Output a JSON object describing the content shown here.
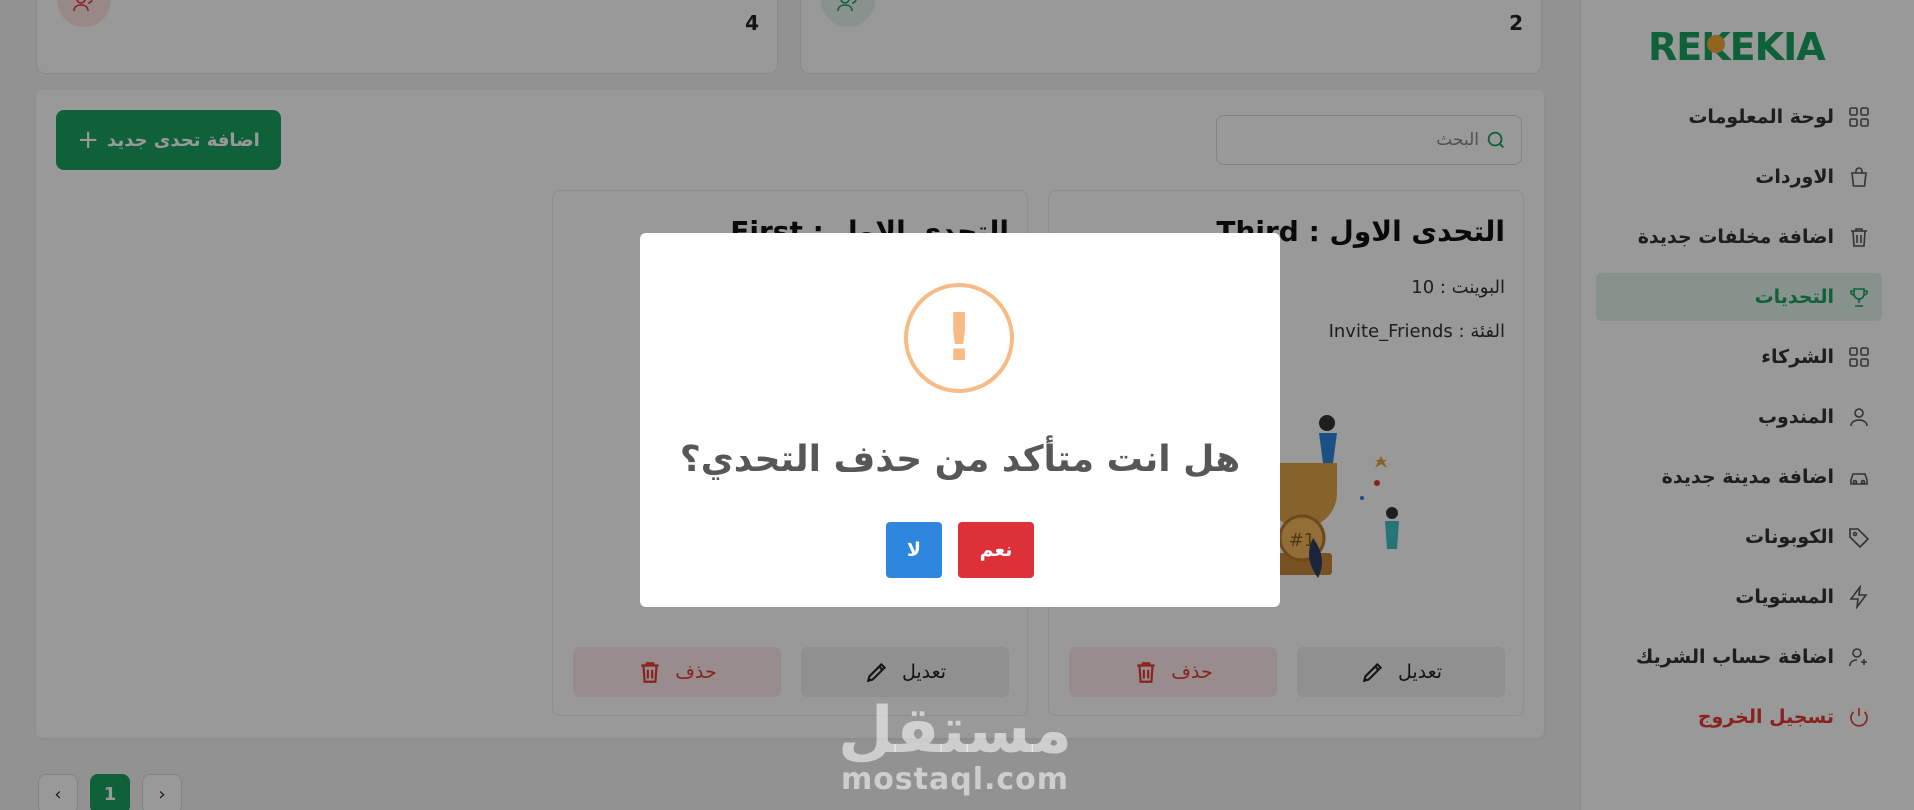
{
  "brand": {
    "logo_text": "REKEKIA",
    "colors": {
      "primary": "#1aa260",
      "danger": "#e53935",
      "warning": "#f8bb86",
      "info": "#2e86de"
    }
  },
  "sidebar": {
    "items": [
      {
        "label": "لوحة المعلومات",
        "icon": "grid-icon"
      },
      {
        "label": "الاوردات",
        "icon": "bag-icon"
      },
      {
        "label": "اضافة مخلفات جديدة",
        "icon": "trash-icon"
      },
      {
        "label": "التحديات",
        "icon": "trophy-icon",
        "active": true
      },
      {
        "label": "الشركاء",
        "icon": "grid-icon"
      },
      {
        "label": "المندوب",
        "icon": "user-icon"
      },
      {
        "label": "اضافة مدينة جديدة",
        "icon": "car-icon"
      },
      {
        "label": "الكوبونات",
        "icon": "tag-icon"
      },
      {
        "label": "المستويات",
        "icon": "bolt-icon"
      },
      {
        "label": "اضافة حساب الشريك",
        "icon": "user-add-icon"
      },
      {
        "label": "تسجيل الخروج",
        "icon": "power-icon"
      }
    ]
  },
  "stats": [
    {
      "value": "4",
      "icon": "users-icon",
      "color": "#e53935"
    },
    {
      "value": "2",
      "icon": "users-icon",
      "color": "#1aa260"
    }
  ],
  "toolbar": {
    "add_label": "اضافة تحدى جديد",
    "add_plus": "+",
    "search_placeholder": "البحث"
  },
  "challenges": [
    {
      "title": "التحدى الاول : Third",
      "points": "البوينت : 10",
      "category": "الفئة : Invite_Friends",
      "edit_label": "تعديل",
      "delete_label": "حذف"
    },
    {
      "title": "التحدى الاول : First",
      "points": "",
      "category": "",
      "edit_label": "تعديل",
      "delete_label": "حذف"
    }
  ],
  "pagination": {
    "prev": "‹",
    "current": "1",
    "next": "›"
  },
  "modal": {
    "icon": "!",
    "question": "هل انت متأكد من حذف التحدي؟",
    "yes_label": "نعم",
    "no_label": "لا"
  },
  "watermark": {
    "ar": "مستقل",
    "en": "mostaql.com"
  }
}
